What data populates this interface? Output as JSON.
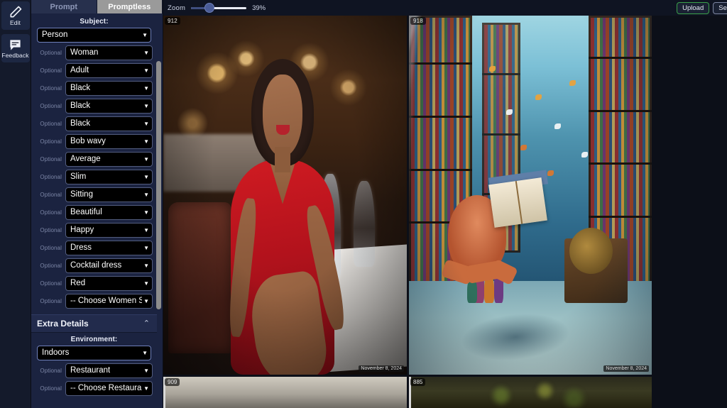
{
  "rail": {
    "items": [
      {
        "label": "Edit",
        "icon": "pencil-icon"
      },
      {
        "label": "Feedback",
        "icon": "speech-bubble-icon"
      }
    ]
  },
  "panel": {
    "tabs": [
      {
        "label": "Prompt",
        "active": false
      },
      {
        "label": "Promptless",
        "active": true
      }
    ],
    "subject": {
      "title": "Subject:",
      "primary": {
        "value": "Person"
      },
      "optional_label": "Optional",
      "fields": [
        {
          "label": "Optional",
          "value": "Woman"
        },
        {
          "label": "Optional",
          "value": "Adult"
        },
        {
          "label": "Optional",
          "value": "Black"
        },
        {
          "label": "Optional",
          "value": "Black"
        },
        {
          "label": "Optional",
          "value": "Black"
        },
        {
          "label": "Optional",
          "value": "Bob wavy"
        },
        {
          "label": "Optional",
          "value": "Average"
        },
        {
          "label": "Optional",
          "value": "Slim"
        },
        {
          "label": "Optional",
          "value": "Sitting"
        },
        {
          "label": "Optional",
          "value": "Beautiful"
        },
        {
          "label": "Optional",
          "value": "Happy"
        },
        {
          "label": "Optional",
          "value": "Dress"
        },
        {
          "label": "Optional",
          "value": "Cocktail dress"
        },
        {
          "label": "Optional",
          "value": "Red"
        },
        {
          "label": "Optional",
          "value": "-- Choose Women Sh"
        }
      ]
    },
    "extra_details": {
      "heading": "Extra Details",
      "collapse_icon": "chevron-up-icon",
      "environment_title": "Environment:",
      "primary": {
        "value": "Indoors"
      },
      "fields": [
        {
          "label": "Optional",
          "value": "Restaurant"
        },
        {
          "label": "Optional",
          "value": "-- Choose Restaurant"
        }
      ]
    }
  },
  "toolbar": {
    "zoom_label": "Zoom",
    "zoom_value": "39%",
    "zoom_percent": 39,
    "upload_label": "Upload",
    "select_label": "Selec"
  },
  "gallery": {
    "images": [
      {
        "id": "912",
        "stamp": "November 8, 2024",
        "alt": "woman-in-red-dress-restaurant"
      },
      {
        "id": "918",
        "stamp": "November 8, 2024",
        "alt": "underwater-library-octopus"
      }
    ],
    "strips": [
      {
        "id": "909"
      },
      {
        "id": "885"
      }
    ]
  },
  "colors": {
    "accent_green": "#3aa14a",
    "panel_bg": "#1b2340",
    "rail_bg": "#141a2b",
    "active_tab_bg": "#9a9a9a",
    "canvas_bg": "#0c0f18"
  }
}
